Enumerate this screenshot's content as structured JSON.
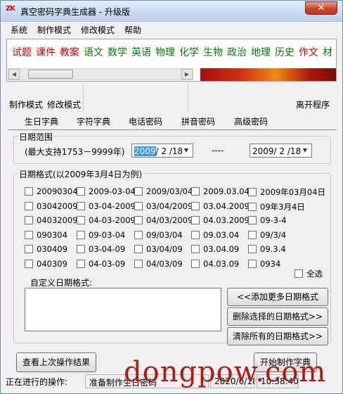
{
  "window": {
    "title": "真空密码字典生成器 - 升级版",
    "app_icon_text": "ZK",
    "close_glyph": "✕"
  },
  "menu": [
    "系统",
    "制作模式",
    "修改模式",
    "帮助"
  ],
  "subjects": [
    {
      "label": "试题",
      "color": "#cc0000"
    },
    {
      "label": "课件",
      "color": "#cc0000"
    },
    {
      "label": "教案",
      "color": "#cc0000"
    },
    {
      "label": "语文",
      "color": "#008000"
    },
    {
      "label": "数学",
      "color": "#008000"
    },
    {
      "label": "英语",
      "color": "#008000"
    },
    {
      "label": "物理",
      "color": "#008000"
    },
    {
      "label": "化学",
      "color": "#008000"
    },
    {
      "label": "生物",
      "color": "#008000"
    },
    {
      "label": "政治",
      "color": "#008000"
    },
    {
      "label": "地理",
      "color": "#008000"
    },
    {
      "label": "历史",
      "color": "#008000"
    },
    {
      "label": "作文",
      "color": "#cc0000"
    },
    {
      "label": "材",
      "color": "#008000"
    }
  ],
  "toolbar": {
    "make_mode": "制作模式",
    "modify_mode": "修改模式",
    "exit": "离开程序"
  },
  "tabs": [
    "生日字典",
    "字符字典",
    "电话密码",
    "拼音密码",
    "高级密码"
  ],
  "date_range": {
    "group_label": "日期范围",
    "support_note": "(最大支持1753－9999年)",
    "start_selected": "2009",
    "start_rest": "/ 2 /18",
    "separator": "----",
    "end": "2009/ 2 /18"
  },
  "date_format": {
    "group_label": "日期格式(以2009年3月4日为例)",
    "rows": [
      [
        "20090304",
        "2009-03-04",
        "2009/03/04",
        "2009.03.04",
        "2009年03月04日"
      ],
      [
        "03042009",
        "03-04-2009",
        "03/04/2009",
        "03.04.2009",
        "09年3月4日"
      ],
      [
        "04032009",
        "04-03-2009",
        "04/03/2009",
        "04.03.2009",
        "09-3-4"
      ],
      [
        "090304",
        "09-03-04",
        "09/03/04",
        "09.03.04",
        "09/3/4"
      ],
      [
        "030409",
        "03-04-09",
        "03/04/09",
        "03.04.09",
        "09.3.4"
      ],
      [
        "040309",
        "04-03-09",
        "04/03/09",
        "04.03.09",
        "0934"
      ]
    ],
    "select_all": "全选",
    "custom_label": "自定义日期格式:",
    "add_button": "<<添加更多日期格式",
    "delete_button": "删除选择的日期格式>>",
    "clear_button": "清除所有的日期格式>>"
  },
  "actions": {
    "view_last": "查看上次操作结果",
    "start": "开始制作字典"
  },
  "status": {
    "label": "正在进行的操作:",
    "message": "准备制作生日密码",
    "date": "2020/6/18",
    "time": "10:38:40"
  },
  "watermark": "dongpow.com"
}
